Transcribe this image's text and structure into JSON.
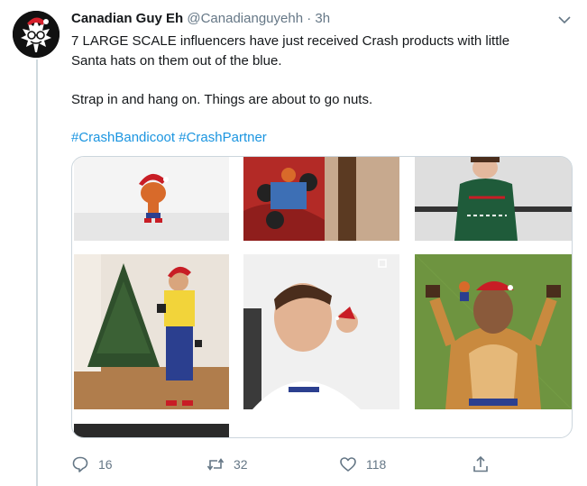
{
  "tweet": {
    "author_name": "Canadian Guy Eh",
    "author_handle": "@Canadianguyehh",
    "separator": "·",
    "time": "3h",
    "line1": "7 LARGE SCALE influencers have just received Crash products with little",
    "line2": "Santa hats on them out of the blue.",
    "line3": "Strap in and hang on. Things are about to go nuts.",
    "hashtags": [
      "#CrashBandicoot",
      "#CrashPartner"
    ]
  },
  "actions": {
    "reply_count": "16",
    "retweet_count": "32",
    "like_count": "118"
  },
  "icons": {
    "caret": "chevron-down-icon",
    "reply": "reply-icon",
    "retweet": "retweet-icon",
    "like": "heart-icon",
    "share": "share-icon"
  },
  "colors": {
    "link": "#1b95e0",
    "muted": "#657786",
    "border": "#ccd6dd"
  }
}
